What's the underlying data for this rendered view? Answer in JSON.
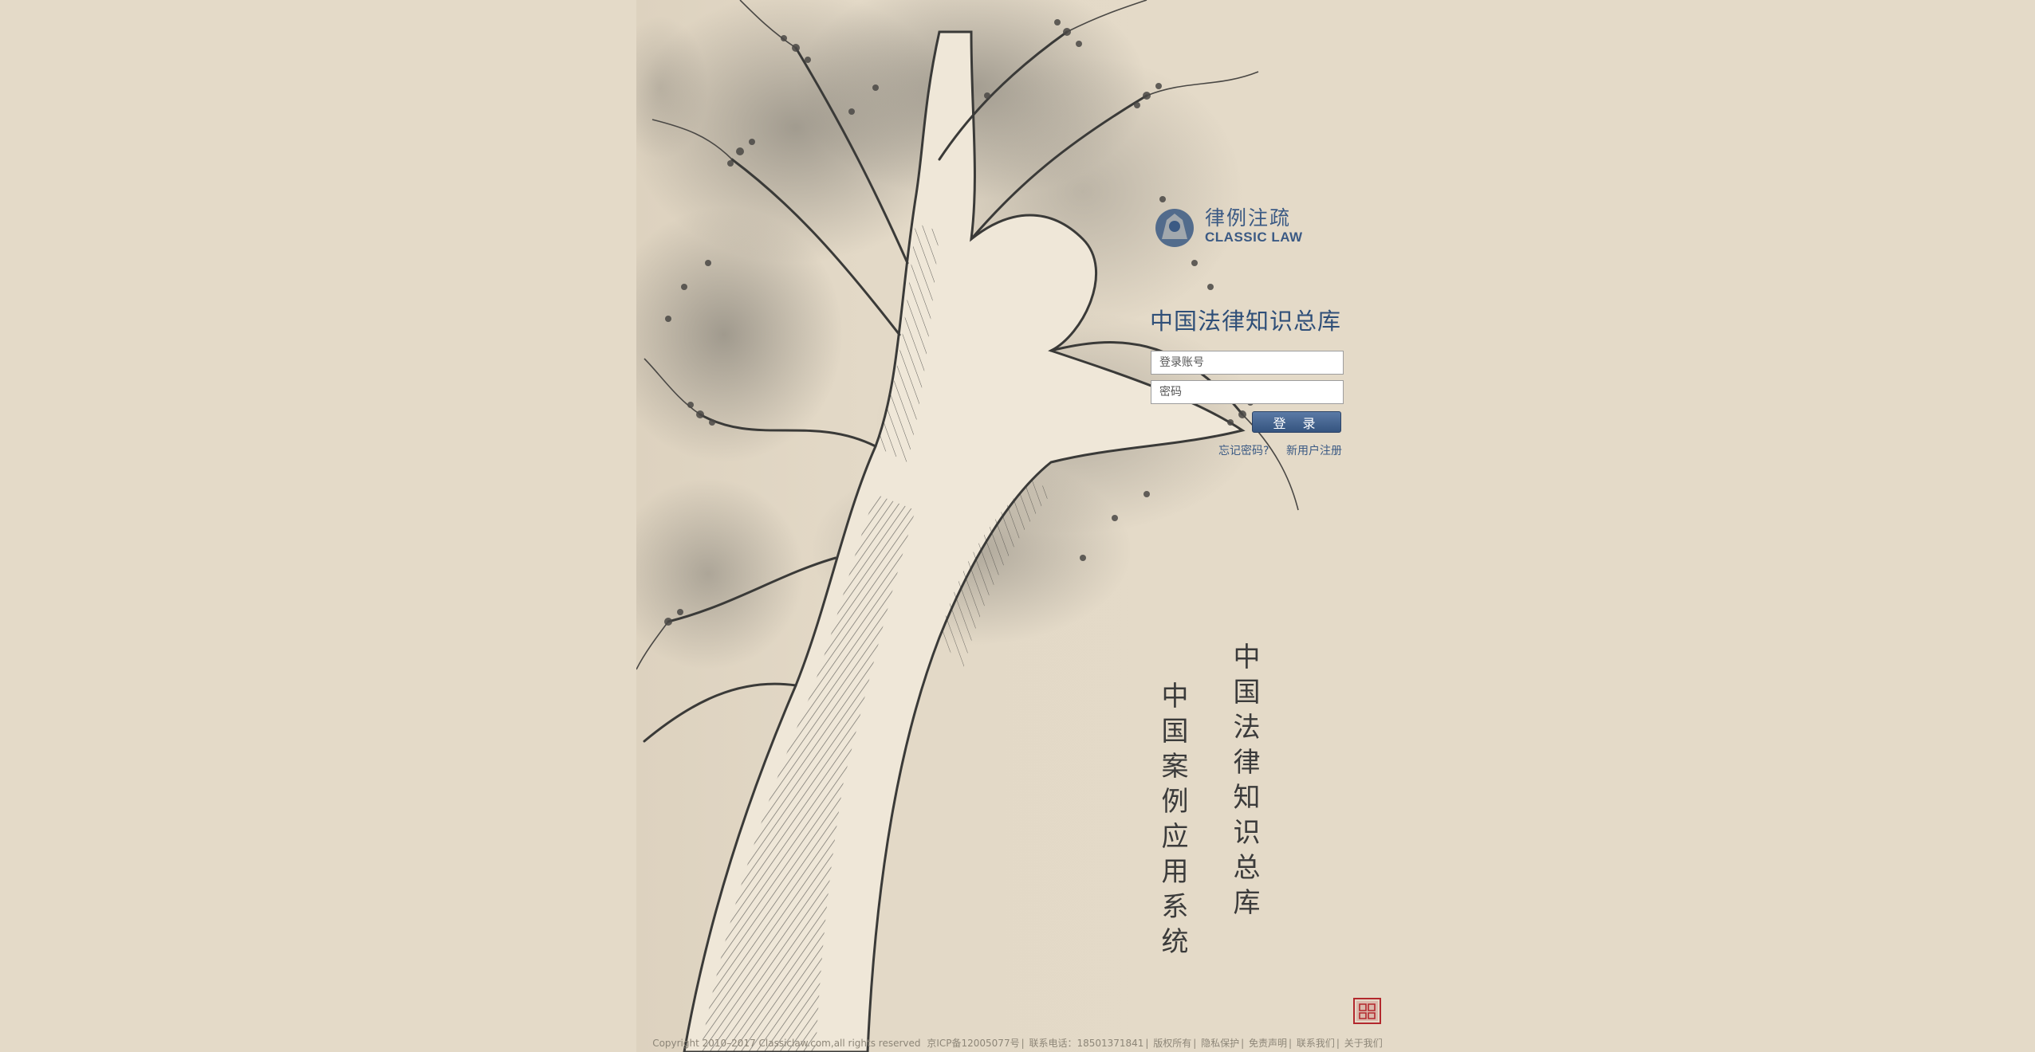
{
  "brand": {
    "name_cn": "律例注疏",
    "name_en": "CLASSIC LAW"
  },
  "login": {
    "title": "中国法律知识总库",
    "account_placeholder": "登录账号",
    "password_placeholder": "密码",
    "submit_label": "登 录",
    "forgot_link": "忘记密码?",
    "register_link": "新用户注册"
  },
  "slogans": {
    "right": "中国法律知识总库",
    "left": "中国案例应用系统"
  },
  "seal": {
    "text": "律例注疏",
    "color": "#b3282d"
  },
  "footer": {
    "copyright": "Copyright 2010–2017 Classiclaw.com,all rights reserved",
    "icp": "京ICP备12005077号",
    "phone": "联系电话：18501371841",
    "rights": "版权所有",
    "privacy": "隐私保护",
    "disclaimer": "免责声明",
    "contact": "联系我们",
    "about": "关于我们"
  },
  "colors": {
    "background": "#e4dac8",
    "accent": "#3b5a84",
    "button": "#3f5e8a"
  }
}
